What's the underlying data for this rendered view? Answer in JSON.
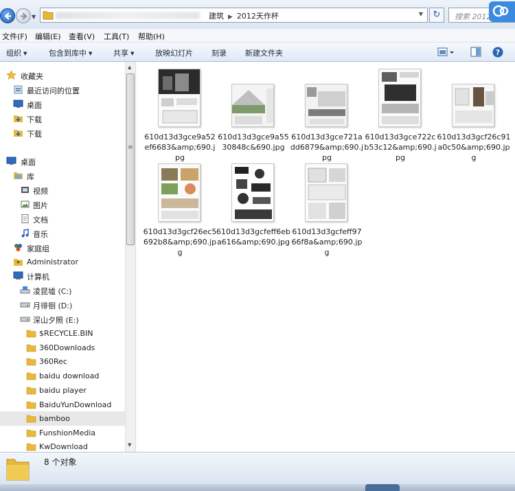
{
  "window": {
    "breadcrumb": [
      "建筑",
      "2012天作杯"
    ],
    "search_placeholder": "搜索 2012..."
  },
  "menu": [
    "文件(F)",
    "编辑(E)",
    "查看(V)",
    "工具(T)",
    "帮助(H)"
  ],
  "toolbar": {
    "organize": "组织",
    "include": "包含到库中",
    "share": "共享",
    "slideshow": "放映幻灯片",
    "burn": "刻录",
    "new_folder": "新建文件夹"
  },
  "nav": {
    "favorites": "收藏夹",
    "recent": "最近访问的位置",
    "desktop_fav": "桌面",
    "downloads1": "下载",
    "downloads2": "下载",
    "desktop": "桌面",
    "libraries": "库",
    "videos": "视频",
    "pictures": "图片",
    "documents": "文档",
    "music": "音乐",
    "homegroup": "家庭组",
    "admin": "Administrator",
    "computer": "计算机",
    "drive_c": "凌昆墟 (C:)",
    "drive_d": "月徘徊 (D:)",
    "drive_e": "深山夕照 (E:)",
    "folders": [
      "$RECYCLE.BIN",
      "360Downloads",
      "360Rec",
      "baidu download",
      "baidu player",
      "BaiduYunDownload",
      "bamboo",
      "FunshionMedia",
      "KwDownload"
    ]
  },
  "files": [
    "610d13d3gce9a52ef6683&amp;690.jpg",
    "610d13d3gce9a5530848c&690.jpg",
    "610d13d3gce721add6879&amp;690.jpg",
    "610d13d3gce722cb53c12&amp;690.jpg",
    "610d13d3gcf26c91a0c50&amp;690.jpg",
    "610d13d3gcf26ec5692b8&amp;690.jpg",
    "610d13d3gcfeff6eba616&amp;690.jpg",
    "610d13d3gcfeff9766f8a&amp;690.jpg"
  ],
  "details": {
    "count": "8 个对象"
  },
  "colors": {
    "accent": "#1d5fb8",
    "folder": "#e8b93a",
    "selection": "#e8e8e8"
  }
}
